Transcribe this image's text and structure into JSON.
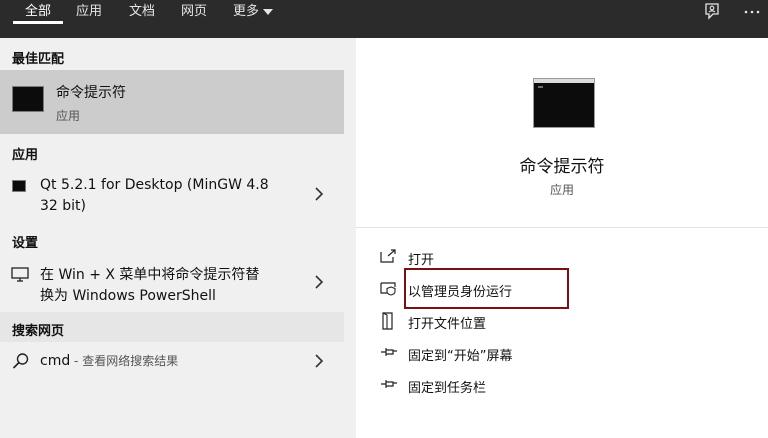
{
  "tabs": [
    {
      "label": "全部",
      "active": true
    },
    {
      "label": "应用"
    },
    {
      "label": "文档"
    },
    {
      "label": "网页"
    },
    {
      "label": "更多"
    }
  ],
  "topbar_icons": [
    "feedback-icon",
    "more-options-icon"
  ],
  "best_match": {
    "header": "最佳匹配",
    "title": "命令提示符",
    "subtitle": "应用",
    "icon": "cmd-icon"
  },
  "apps": {
    "header": "应用",
    "items": [
      {
        "line1": "Qt 5.2.1 for Desktop (MinGW 4.8",
        "line2": "32 bit)",
        "icon": "cmd-icon"
      }
    ]
  },
  "settings": {
    "header": "设置",
    "items": [
      {
        "line1": "在 Win + X 菜单中将命令提示符替",
        "line2": "换为 Windows PowerShell",
        "icon": "monitor-icon"
      }
    ]
  },
  "web": {
    "header": "搜索网页",
    "items": [
      {
        "query": "cmd",
        "suffix": " - 查看网络搜索结果",
        "icon": "search-icon"
      }
    ]
  },
  "detail": {
    "title": "命令提示符",
    "subtitle": "应用",
    "actions": [
      {
        "label": "打开",
        "icon": "open-icon"
      },
      {
        "label": "以管理员身份运行",
        "icon": "shield-run-icon"
      },
      {
        "label": "打开文件位置",
        "icon": "file-location-icon"
      },
      {
        "label": "固定到“开始”屏幕",
        "icon": "pin-icon"
      },
      {
        "label": "固定到任务栏",
        "icon": "pin-icon"
      }
    ]
  },
  "colors": {
    "topbar": "#2b2b2b",
    "selected": "#cccccc",
    "section_header": "#e6e6e6",
    "highlight": "#7a1010"
  }
}
